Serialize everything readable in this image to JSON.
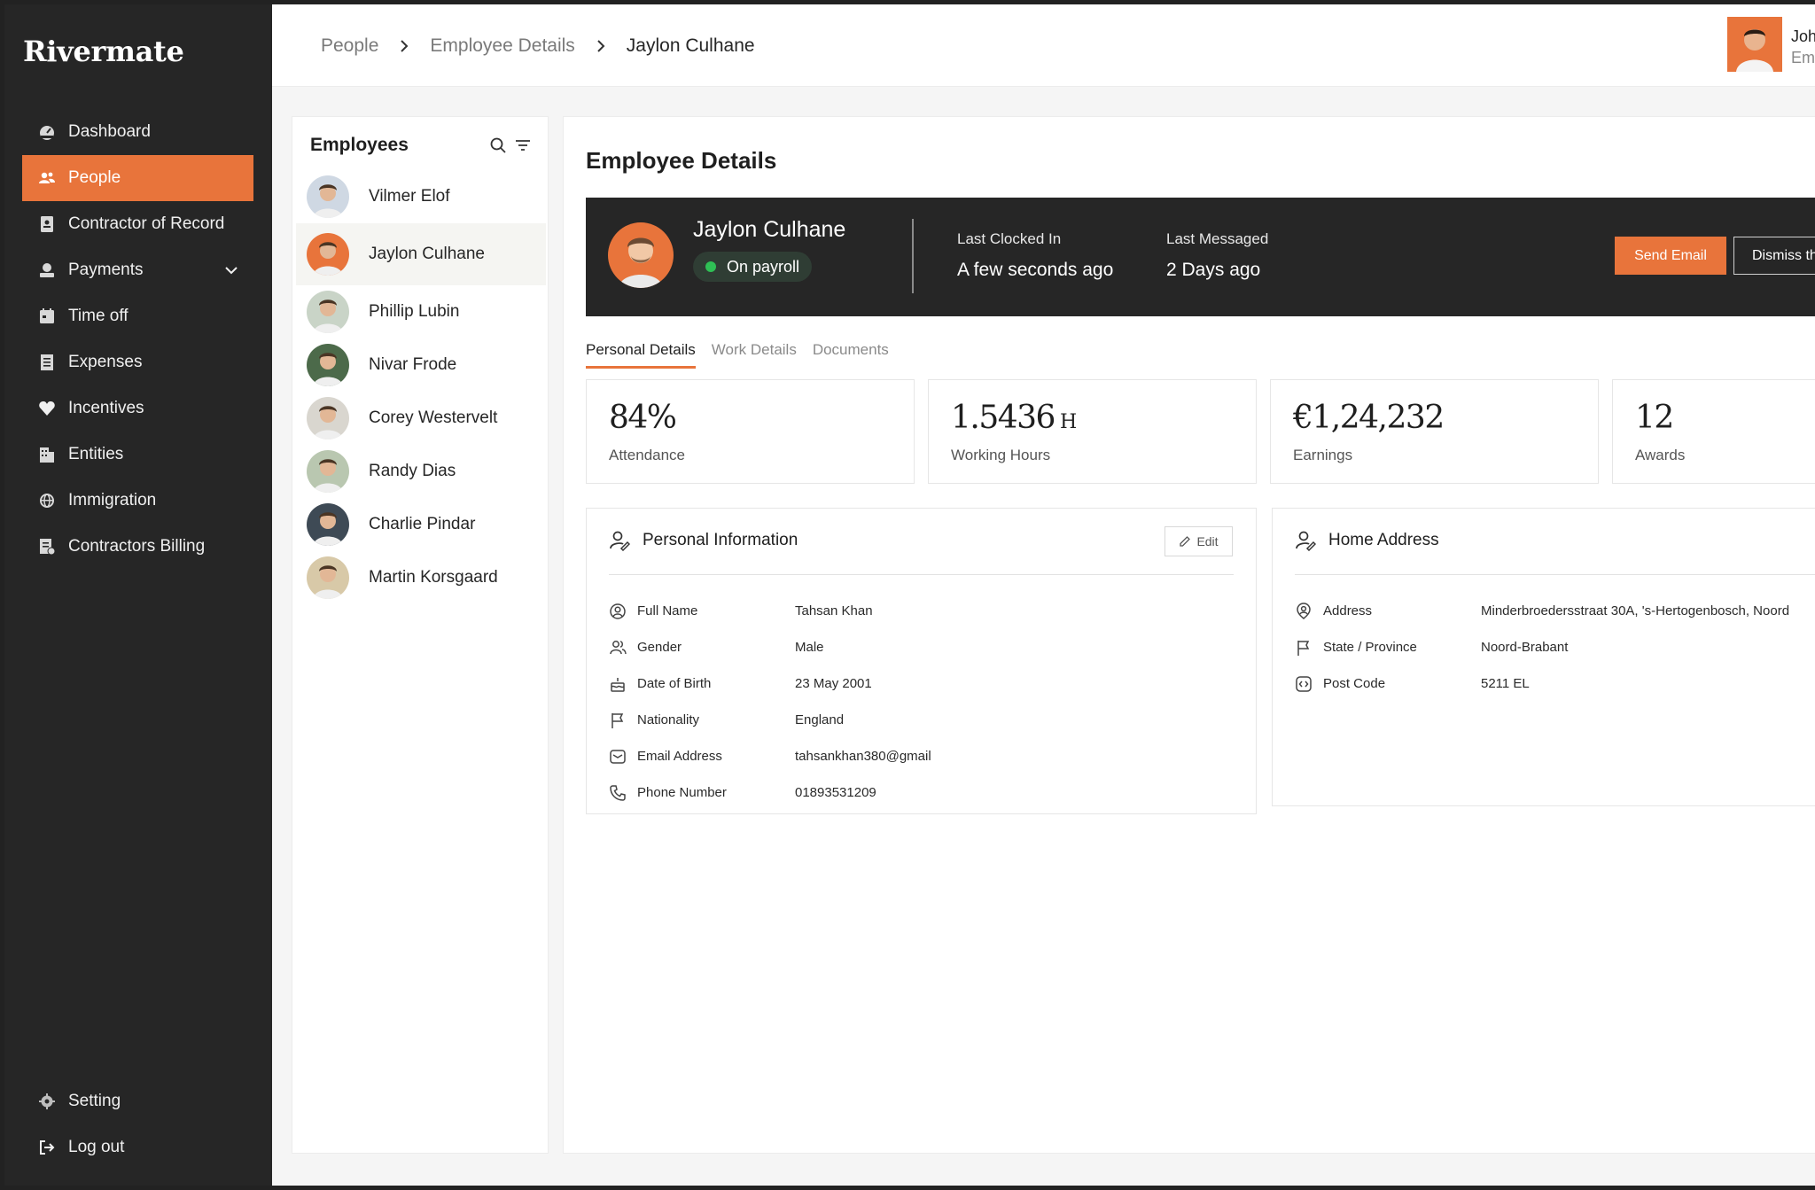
{
  "brand": {
    "name": "Rivermate"
  },
  "nav": {
    "items": [
      {
        "label": "Dashboard",
        "icon": "dashboard-icon"
      },
      {
        "label": "People",
        "icon": "people-icon",
        "active": true
      },
      {
        "label": "Contractor of Record",
        "icon": "contract-icon"
      },
      {
        "label": "Payments",
        "icon": "payments-icon",
        "has_submenu": true
      },
      {
        "label": "Time off",
        "icon": "calendar-icon"
      },
      {
        "label": "Expenses",
        "icon": "receipt-icon"
      },
      {
        "label": "Incentives",
        "icon": "heart-icon"
      },
      {
        "label": "Entities",
        "icon": "building-icon"
      },
      {
        "label": "Immigration",
        "icon": "globe-icon"
      },
      {
        "label": "Contractors Billing",
        "icon": "billing-icon"
      }
    ],
    "bottom": [
      {
        "label": "Setting",
        "icon": "gear-icon"
      },
      {
        "label": "Log out",
        "icon": "logout-icon"
      }
    ]
  },
  "breadcrumb": [
    "People",
    "Employee Details",
    "Jaylon Culhane"
  ],
  "user": {
    "name": "Joh",
    "role": "Em"
  },
  "employees": {
    "title": "Employees",
    "list": [
      {
        "name": "Vilmer Elof",
        "bg": "#cfd8e3"
      },
      {
        "name": "Jaylon Culhane",
        "bg": "#e8743b",
        "selected": true
      },
      {
        "name": "Phillip Lubin",
        "bg": "#c9d4c7"
      },
      {
        "name": "Nivar Frode",
        "bg": "#4c6a4a"
      },
      {
        "name": "Corey Westervelt",
        "bg": "#d9d6cf"
      },
      {
        "name": "Randy Dias",
        "bg": "#b9c7b0"
      },
      {
        "name": "Charlie Pindar",
        "bg": "#3e4a55"
      },
      {
        "name": "Martin Korsgaard",
        "bg": "#d8c9a8"
      }
    ]
  },
  "details": {
    "title": "Employee Details",
    "banner": {
      "name": "Jaylon Culhane",
      "status": "On payroll",
      "last_clocked_label": "Last Clocked In",
      "last_clocked_value": "A few seconds ago",
      "last_messaged_label": "Last Messaged",
      "last_messaged_value": "2 Days ago",
      "send_email": "Send Email",
      "dismiss": "Dismiss th"
    },
    "tabs": [
      {
        "label": "Personal Details",
        "active": true
      },
      {
        "label": "Work Details"
      },
      {
        "label": "Documents"
      }
    ],
    "stats": [
      {
        "value": "84%",
        "unit": "",
        "label": "Attendance"
      },
      {
        "value": "1.5436",
        "unit": "H",
        "label": "Working Hours"
      },
      {
        "value": "€1,24,232",
        "unit": "",
        "label": "Earnings"
      },
      {
        "value": "12",
        "unit": "",
        "label": "Awards"
      }
    ],
    "personal": {
      "title": "Personal Information",
      "edit": "Edit",
      "rows": [
        {
          "label": "Full Name",
          "value": "Tahsan Khan",
          "icon": "user-circle-icon"
        },
        {
          "label": "Gender",
          "value": "Male",
          "icon": "users-icon"
        },
        {
          "label": "Date of Birth",
          "value": "23 May 2001",
          "icon": "cake-icon"
        },
        {
          "label": "Nationality",
          "value": "England",
          "icon": "flag-icon"
        },
        {
          "label": "Email Address",
          "value": "tahsankhan380@gmail",
          "icon": "mail-icon"
        },
        {
          "label": "Phone Number",
          "value": "01893531209",
          "icon": "phone-icon"
        }
      ]
    },
    "address": {
      "title": "Home Address",
      "rows": [
        {
          "label": "Address",
          "value": "Minderbroedersstraat 30A, 's-Hertogenbosch,  Noord",
          "icon": "location-user-icon"
        },
        {
          "label": "State / Province",
          "value": "Noord-Brabant",
          "icon": "flag-icon"
        },
        {
          "label": "Post Code",
          "value": "5211 EL",
          "icon": "code-icon"
        }
      ]
    }
  },
  "colors": {
    "accent": "#e8743b",
    "sidebar": "#262626",
    "status_green": "#2fbf55"
  }
}
